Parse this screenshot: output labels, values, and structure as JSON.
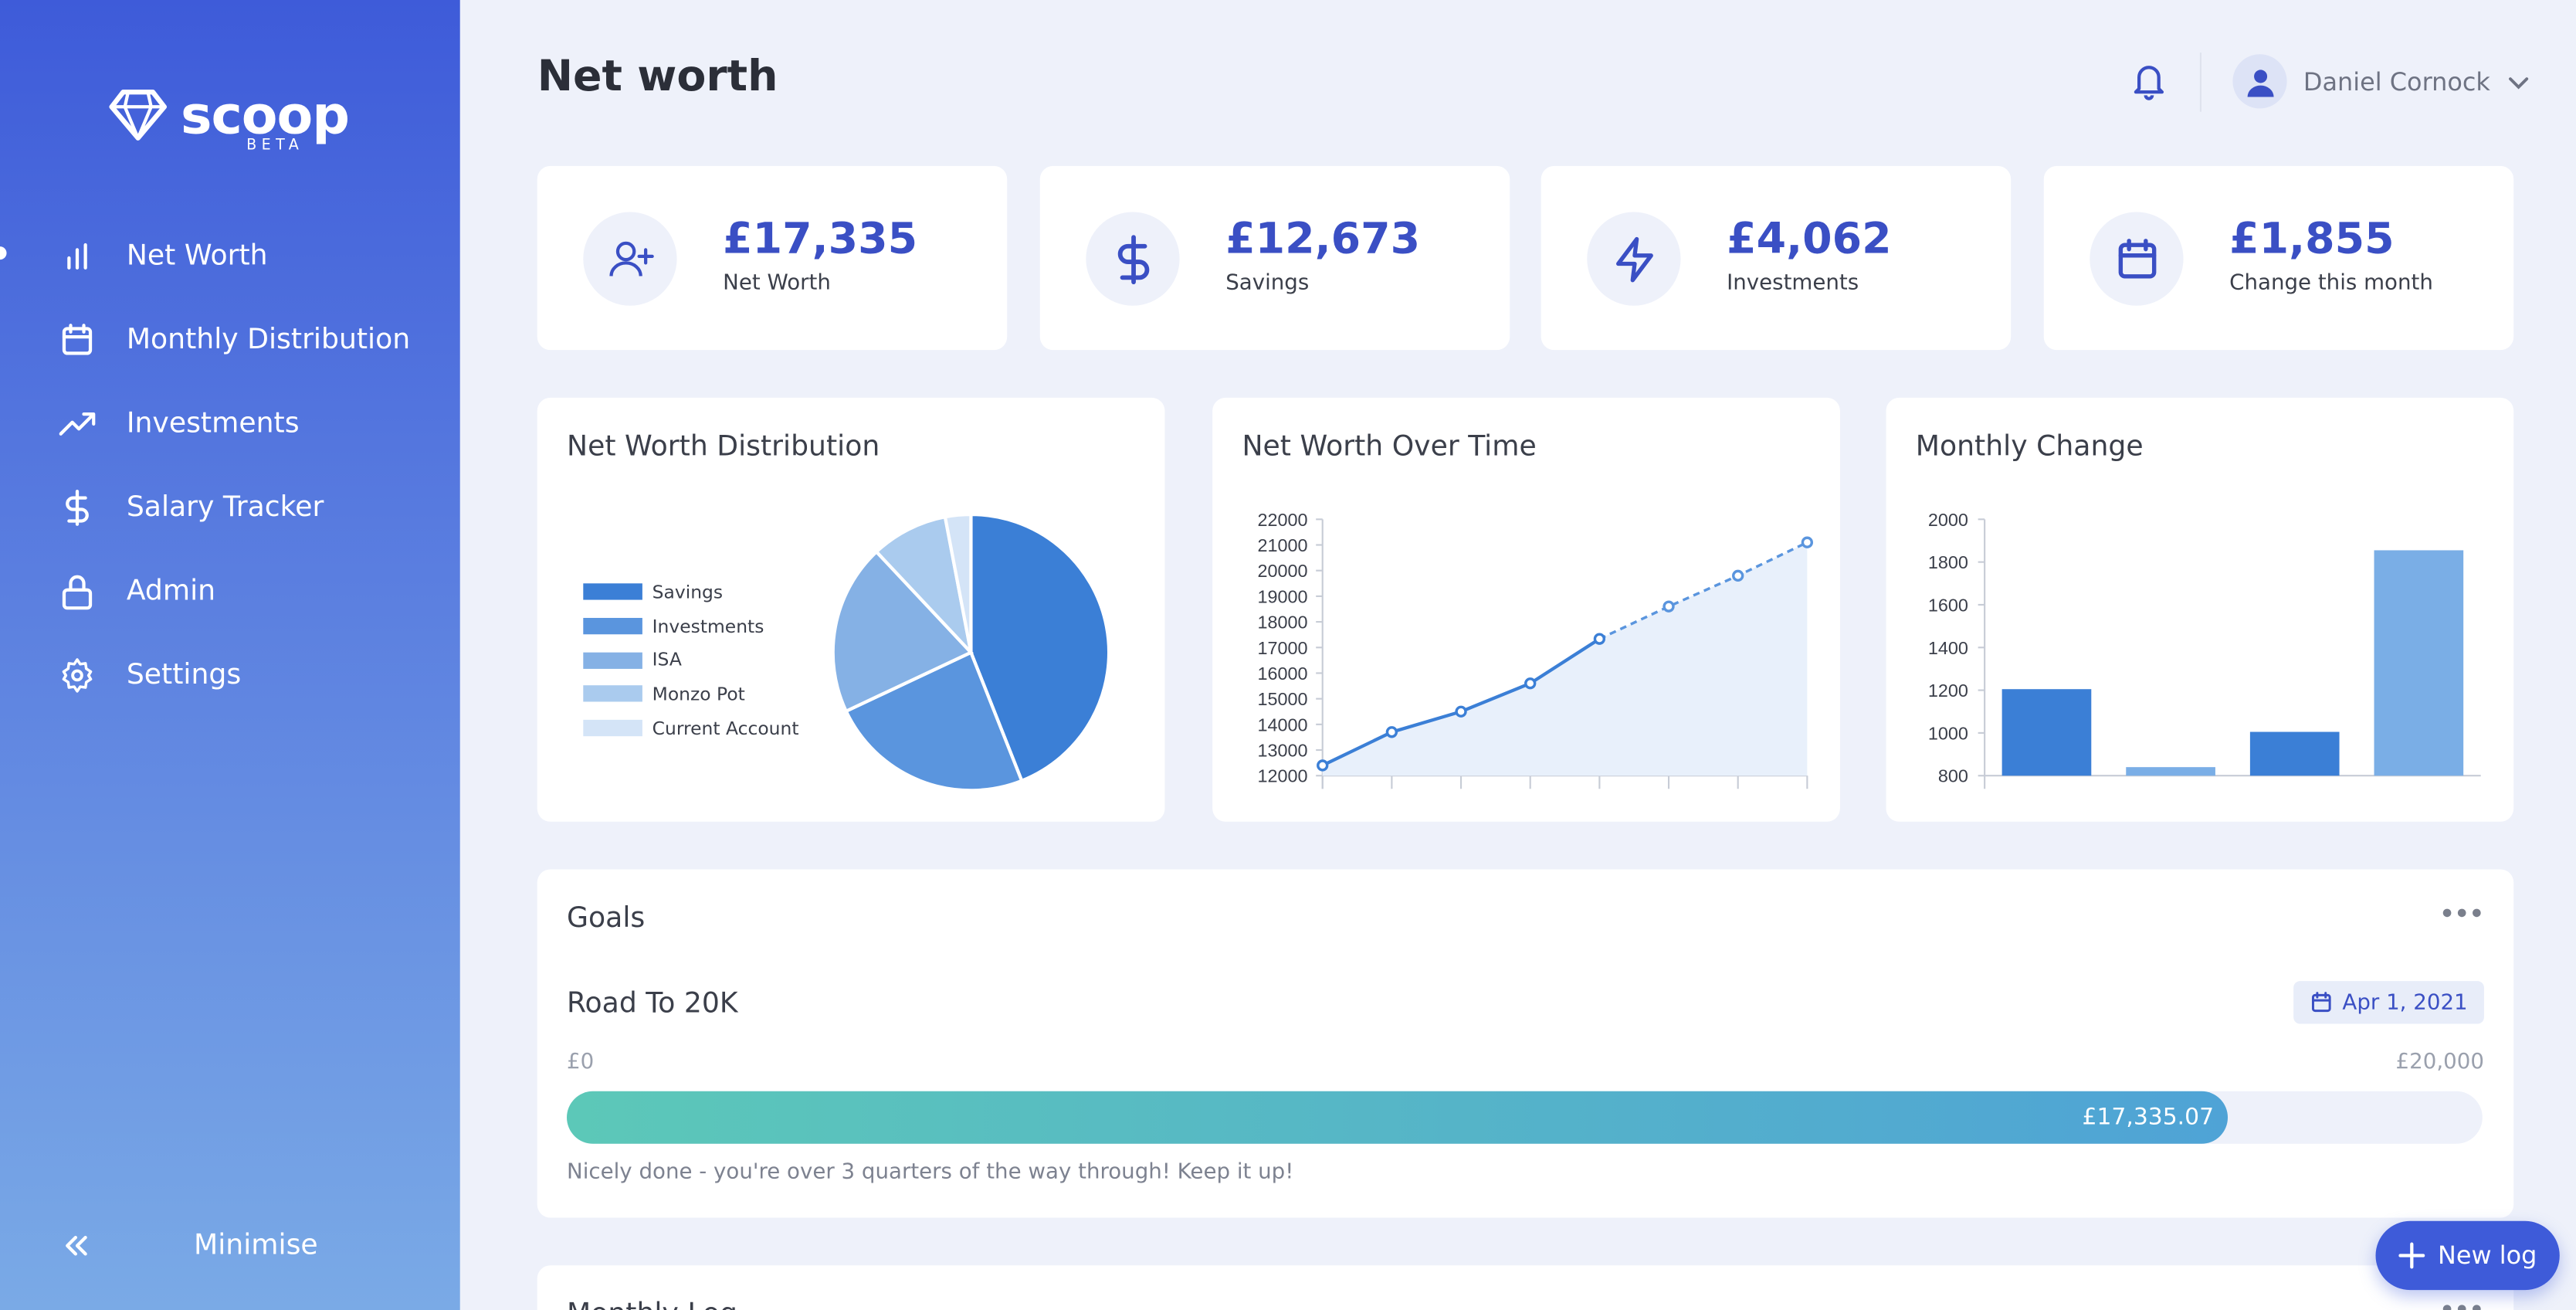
{
  "app": {
    "name": "scoop",
    "tag": "BETA"
  },
  "sidebar": {
    "items": [
      {
        "label": "Net Worth",
        "icon": "bar-chart-icon"
      },
      {
        "label": "Monthly Distribution",
        "icon": "calendar-icon"
      },
      {
        "label": "Investments",
        "icon": "trending-up-icon"
      },
      {
        "label": "Salary Tracker",
        "icon": "dollar-icon"
      },
      {
        "label": "Admin",
        "icon": "lock-icon"
      },
      {
        "label": "Settings",
        "icon": "gear-icon"
      }
    ],
    "minimise_label": "Minimise"
  },
  "header": {
    "title": "Net worth",
    "user_name": "Daniel Cornock"
  },
  "stats": [
    {
      "value": "£17,335",
      "label": "Net Worth",
      "icon": "user-plus-icon"
    },
    {
      "value": "£12,673",
      "label": "Savings",
      "icon": "dollar-icon"
    },
    {
      "value": "£4,062",
      "label": "Investments",
      "icon": "lightning-icon"
    },
    {
      "value": "£1,855",
      "label": "Change this month",
      "icon": "calendar-icon"
    }
  ],
  "panels": {
    "distribution_title": "Net Worth Distribution",
    "over_time_title": "Net Worth Over Time",
    "monthly_change_title": "Monthly Change"
  },
  "chart_data": [
    {
      "type": "pie",
      "title": "Net Worth Distribution",
      "categories": [
        "Savings",
        "Investments",
        "ISA",
        "Monzo Pot",
        "Current Account"
      ],
      "values": [
        44,
        24,
        20,
        9,
        3
      ],
      "colors": [
        "#3b7fd6",
        "#5a95de",
        "#85b1e5",
        "#aacbee",
        "#d4e4f7"
      ]
    },
    {
      "type": "line",
      "title": "Net Worth Over Time",
      "x": [
        1,
        2,
        3,
        4,
        5,
        6,
        7,
        8
      ],
      "series": [
        {
          "values": [
            12400,
            13700,
            14500,
            15600,
            17335,
            18600,
            19800,
            21100
          ]
        }
      ],
      "projected_from_index": 4,
      "ylim": [
        12000,
        22000
      ],
      "yticks": [
        12000,
        13000,
        14000,
        15000,
        16000,
        17000,
        18000,
        19000,
        20000,
        21000,
        22000
      ],
      "color": "#3b7fd6"
    },
    {
      "type": "bar",
      "title": "Monthly Change",
      "categories": [
        "1",
        "2",
        "3",
        "4"
      ],
      "values": [
        1205,
        840,
        1005,
        1855
      ],
      "ylim": [
        800,
        2000
      ],
      "yticks": [
        800,
        1000,
        1200,
        1400,
        1600,
        1800,
        2000
      ],
      "colors": [
        "#3b7fd6",
        "#7aaee6",
        "#3b7fd6",
        "#7aaee6"
      ]
    }
  ],
  "goals": {
    "section_title": "Goals",
    "goal_name": "Road To 20K",
    "target_date": "Apr 1, 2021",
    "min_label": "£0",
    "max_label": "£20,000",
    "current_label": "£17,335.07",
    "progress": 0.8667,
    "message": "Nicely done - you're over 3 quarters of the way through! Keep it up!"
  },
  "monthly_log": {
    "title": "Monthly Log"
  },
  "fab": {
    "label": "New log"
  }
}
